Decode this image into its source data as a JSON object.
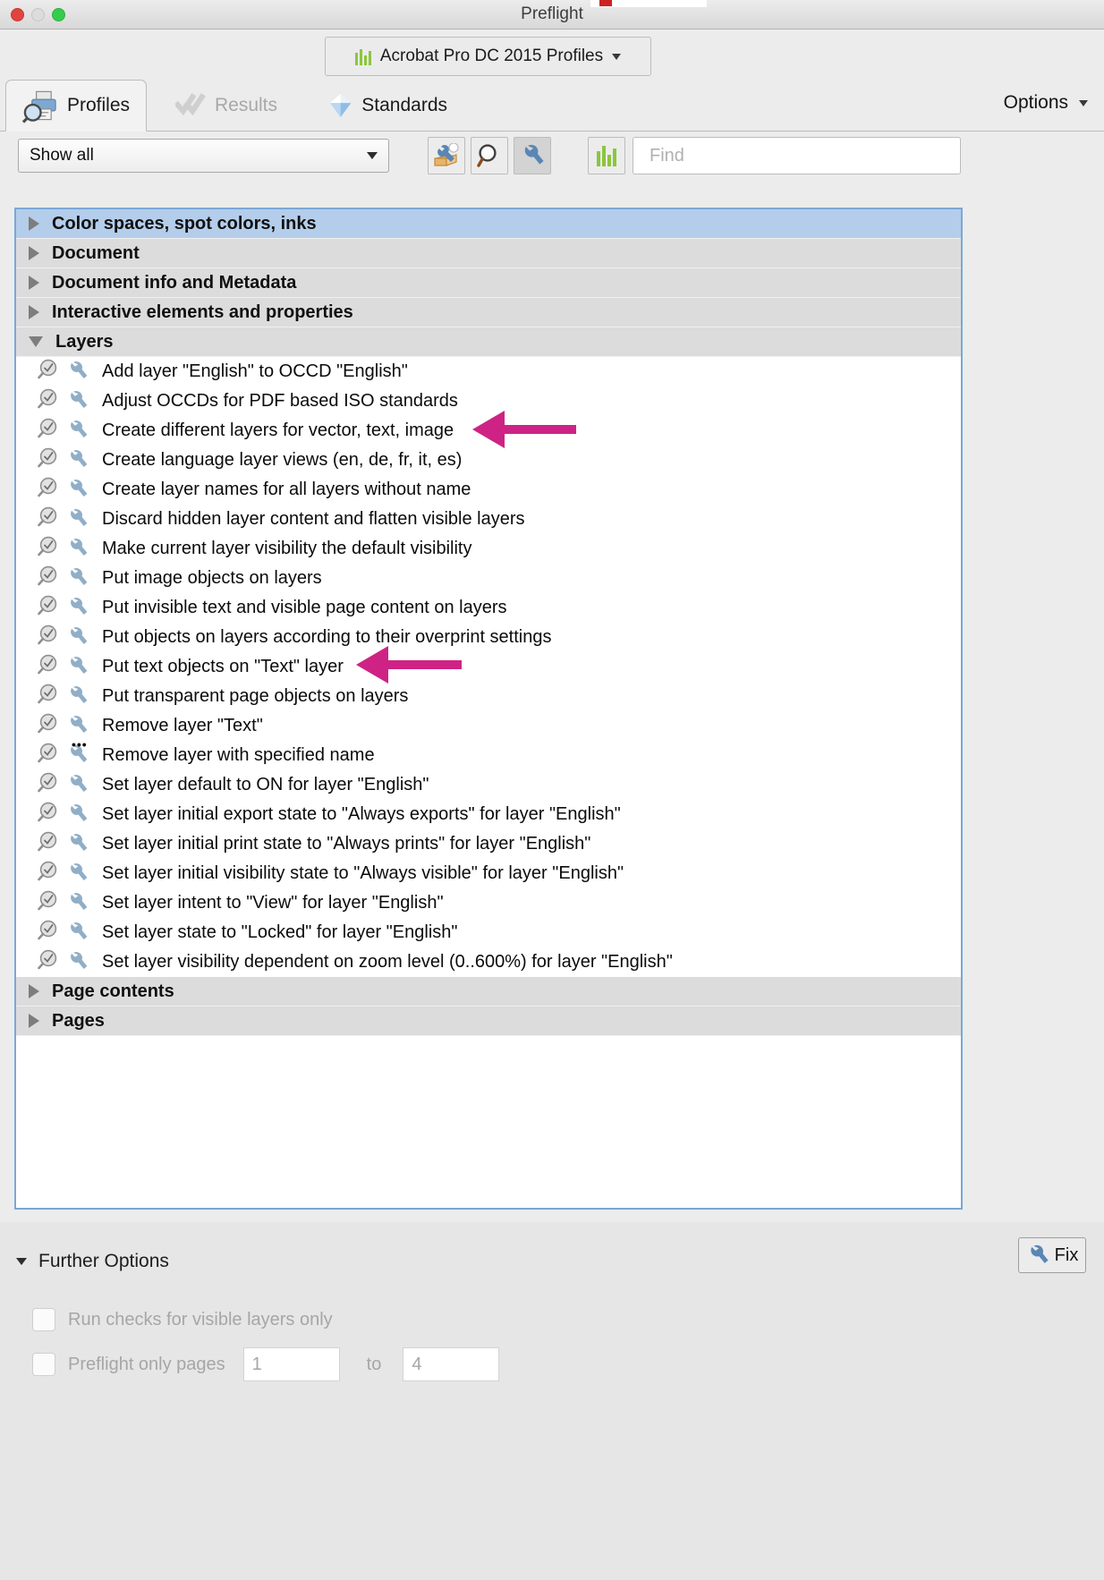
{
  "window": {
    "title": "Preflight",
    "traffic_lights": [
      "close",
      "minimize",
      "zoom"
    ]
  },
  "profile_selector": {
    "label": "Acrobat Pro DC 2015 Profiles",
    "icon": "green-bars-icon",
    "caret": "chevron-down-icon"
  },
  "tabs": [
    {
      "label": "Profiles",
      "icon": "profiles-printer-magnifier-icon",
      "state": "active"
    },
    {
      "label": "Results",
      "icon": "results-checkmarks-icon",
      "state": "disabled"
    },
    {
      "label": "Standards",
      "icon": "standards-diamond-icon",
      "state": "normal"
    }
  ],
  "options_menu": {
    "label": "Options",
    "caret": "chevron-down-icon"
  },
  "toolbar": {
    "filter_dropdown": {
      "value": "Show all"
    },
    "buttons": [
      {
        "name": "edit-profile-button",
        "icon": "wrench-box-icon",
        "pressed": false
      },
      {
        "name": "inspect-button",
        "icon": "magnifier-icon",
        "pressed": false
      },
      {
        "name": "fixups-button",
        "icon": "wrench-icon",
        "pressed": true
      },
      {
        "name": "show-bars-button",
        "icon": "green-bars-icon",
        "pressed": false
      }
    ],
    "find": {
      "placeholder": "Find",
      "value": ""
    }
  },
  "list": {
    "groups": [
      {
        "label": "Color spaces, spot colors, inks",
        "expanded": false,
        "selected": true,
        "items": []
      },
      {
        "label": "Document",
        "expanded": false,
        "selected": false,
        "items": []
      },
      {
        "label": "Document info and Metadata",
        "expanded": false,
        "selected": false,
        "items": []
      },
      {
        "label": "Interactive elements and properties",
        "expanded": false,
        "selected": false,
        "items": []
      },
      {
        "label": "Layers",
        "expanded": true,
        "selected": false,
        "items": [
          {
            "label": "Add layer \"English\" to OCCD \"English\"",
            "has_dots": false
          },
          {
            "label": "Adjust OCCDs for PDF based ISO standards",
            "has_dots": false
          },
          {
            "label": "Create different layers for vector, text, image",
            "has_dots": false,
            "annotated": true
          },
          {
            "label": "Create language layer views (en, de, fr, it, es)",
            "has_dots": false
          },
          {
            "label": "Create layer names for all layers without name",
            "has_dots": false
          },
          {
            "label": "Discard hidden layer content and flatten visible layers",
            "has_dots": false
          },
          {
            "label": "Make current layer visibility the default visibility",
            "has_dots": false
          },
          {
            "label": "Put image objects on layers",
            "has_dots": false
          },
          {
            "label": "Put invisible text and visible page content on layers",
            "has_dots": false
          },
          {
            "label": "Put objects on layers according to their overprint settings",
            "has_dots": false
          },
          {
            "label": "Put text objects on \"Text\" layer",
            "has_dots": false,
            "annotated": true
          },
          {
            "label": "Put transparent page objects on layers",
            "has_dots": false
          },
          {
            "label": "Remove layer \"Text\"",
            "has_dots": false
          },
          {
            "label": "Remove layer with specified name",
            "has_dots": true
          },
          {
            "label": "Set layer default to ON for layer \"English\"",
            "has_dots": false
          },
          {
            "label": "Set layer initial export state to \"Always exports\" for layer \"English\"",
            "has_dots": false
          },
          {
            "label": "Set layer initial print state to \"Always prints\" for layer \"English\"",
            "has_dots": false
          },
          {
            "label": "Set layer initial visibility state to \"Always visible\" for layer \"English\"",
            "has_dots": false
          },
          {
            "label": "Set layer intent to \"View\" for layer \"English\"",
            "has_dots": false
          },
          {
            "label": "Set layer state to \"Locked\" for layer \"English\"",
            "has_dots": false
          },
          {
            "label": "Set layer visibility dependent on zoom level (0..600%) for layer \"English\"",
            "has_dots": false
          }
        ]
      },
      {
        "label": "Page contents",
        "expanded": false,
        "selected": false,
        "items": []
      },
      {
        "label": "Pages",
        "expanded": false,
        "selected": false,
        "items": []
      }
    ]
  },
  "bottom": {
    "further_options_label": "Further Options",
    "further_options_expanded": true,
    "fix_button": {
      "label": "Fix",
      "icon": "wrench-icon"
    },
    "visible_layers_option": {
      "label": "Run checks for visible layers only",
      "checked": false
    },
    "only_pages_option": {
      "label": "Preflight only pages",
      "checked": false,
      "from": "1",
      "to_label": "to",
      "to": "4"
    }
  },
  "annotations": {
    "arrow_color": "#ce2384",
    "arrows": [
      {
        "points_to": "Create different layers for vector, text, image"
      },
      {
        "points_to": "Put text objects on \"Text\" layer"
      }
    ]
  }
}
